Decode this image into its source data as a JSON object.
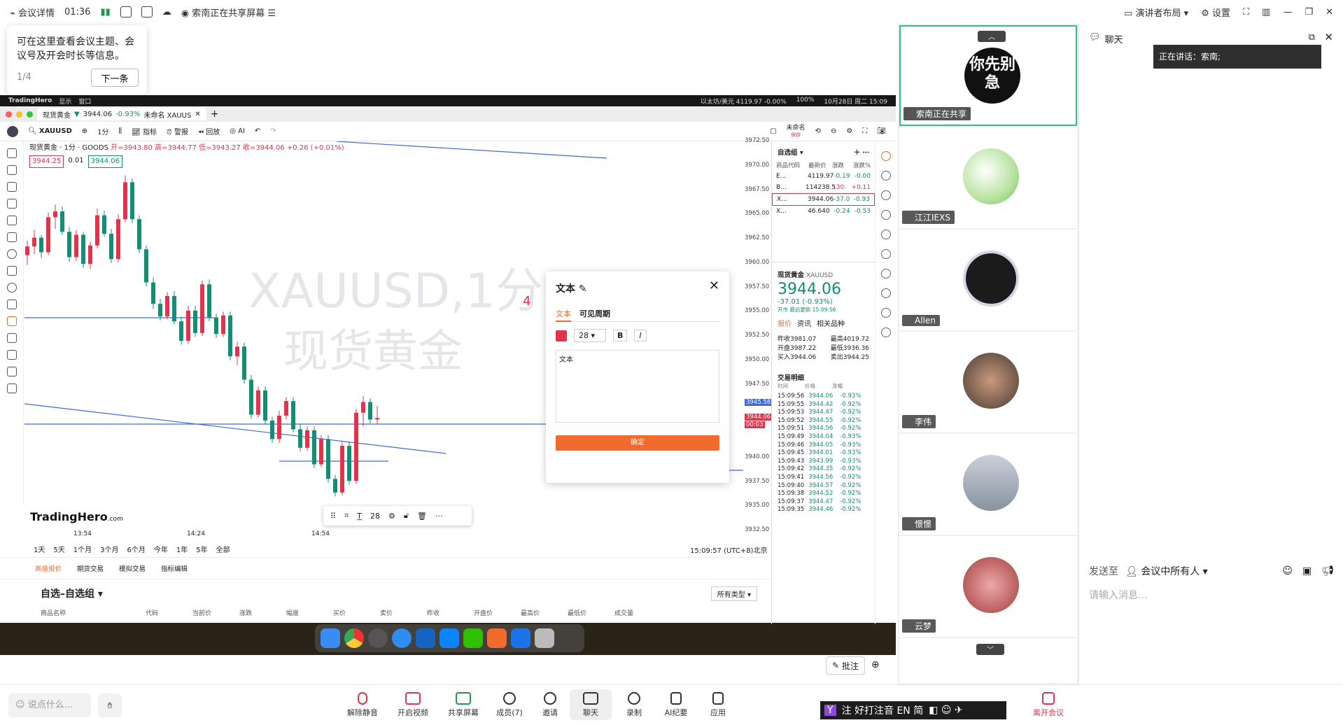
{
  "topbar": {
    "meeting_info": "会议详情",
    "time": "01:36",
    "sharing": "索南正在共享屏幕",
    "presenter_layout": "演讲者布局",
    "settings": "设置"
  },
  "tooltip": {
    "text": "可在这里查看会议主题、会议号及开会时长等信息。",
    "page": "1/4",
    "next": "下一条"
  },
  "mac_menubar": {
    "app": "TradingHero",
    "menu1": "显示",
    "menu2": "窗口",
    "ticker": "以太坊/美元 4119.97 -0.00%",
    "battery": "100%",
    "datetime": "10月28日 周二 15:09"
  },
  "tv_tab": {
    "label": "现货黄金",
    "price": "3944.06",
    "change": "-0.93%",
    "name": "未命名 XAUUS"
  },
  "tv_toolbar": {
    "symbol": "XAUUSD",
    "interval": "1分",
    "indicators": "指标",
    "alerts": "警报",
    "replay": "回放",
    "ai": "AI",
    "unnamed": "未命名",
    "save": "保存"
  },
  "legend": {
    "title": "现货黄金 · 1分 · GOODS",
    "open": "开=3943.80",
    "high": "高=3944.77",
    "low": "低=3943.27",
    "close": "收=3944.06",
    "chg": "+0.26 (+0.01%)",
    "bid": "3944.25",
    "spread": "0.01",
    "ask": "3944.06"
  },
  "watermark": {
    "line1": "XAUUSD,1分",
    "line2": "现货黄金",
    "marker": "4"
  },
  "brand": {
    "name": "TradingHero",
    "suffix": ".com"
  },
  "price_axis": [
    "3972.50",
    "3970.00",
    "3967.50",
    "3965.00",
    "3962.50",
    "3960.00",
    "3957.50",
    "3955.00",
    "3952.50",
    "3950.00",
    "3947.50",
    "3945.58",
    "3944.06",
    "00:03",
    "3940.00",
    "3937.50",
    "3935.00",
    "3932.50"
  ],
  "time_axis": [
    "13:54",
    "14:24",
    "14:54"
  ],
  "colors": {
    "up": "#e0344b",
    "down": "#138d73",
    "line": "#3d6ad6",
    "accent": "#f26a2e"
  },
  "chart_data": {
    "type": "candlestick",
    "symbol": "XAUUSD",
    "interval": "1分",
    "ylim": [
      3932.5,
      3972.5
    ],
    "candles": [
      [
        3960.8,
        3962.3,
        3959.8,
        3961.7
      ],
      [
        3961.7,
        3963.4,
        3960.9,
        3962.6
      ],
      [
        3962.6,
        3962.9,
        3960.5,
        3961.1
      ],
      [
        3961.1,
        3965.2,
        3960.8,
        3964.7
      ],
      [
        3964.7,
        3966.0,
        3963.5,
        3965.3
      ],
      [
        3965.3,
        3965.8,
        3962.9,
        3963.2
      ],
      [
        3963.2,
        3963.7,
        3960.1,
        3960.6
      ],
      [
        3960.6,
        3963.4,
        3960.2,
        3962.9
      ],
      [
        3962.9,
        3963.2,
        3959.5,
        3959.9
      ],
      [
        3959.9,
        3962.2,
        3959.4,
        3961.8
      ],
      [
        3961.8,
        3965.6,
        3961.5,
        3964.9
      ],
      [
        3964.9,
        3965.4,
        3962.7,
        3963.0
      ],
      [
        3963.0,
        3963.5,
        3960.0,
        3960.4
      ],
      [
        3960.4,
        3965.0,
        3960.1,
        3964.5
      ],
      [
        3964.5,
        3969.0,
        3964.2,
        3968.3
      ],
      [
        3968.3,
        3968.7,
        3964.1,
        3964.5
      ],
      [
        3964.5,
        3964.9,
        3961.0,
        3961.4
      ],
      [
        3961.4,
        3961.8,
        3957.6,
        3958.0
      ],
      [
        3958.0,
        3958.5,
        3955.3,
        3955.8
      ],
      [
        3955.8,
        3956.3,
        3954.1,
        3954.5
      ],
      [
        3954.5,
        3957.0,
        3954.2,
        3956.6
      ],
      [
        3956.6,
        3957.1,
        3953.7,
        3954.0
      ],
      [
        3954.0,
        3954.5,
        3951.6,
        3952.0
      ],
      [
        3952.0,
        3955.6,
        3951.7,
        3955.1
      ],
      [
        3955.1,
        3955.6,
        3952.4,
        3952.8
      ],
      [
        3952.8,
        3958.2,
        3952.5,
        3957.8
      ],
      [
        3957.8,
        3958.3,
        3954.0,
        3954.4
      ],
      [
        3954.4,
        3954.8,
        3952.3,
        3952.7
      ],
      [
        3952.7,
        3955.0,
        3952.4,
        3954.6
      ],
      [
        3954.6,
        3955.0,
        3950.0,
        3950.4
      ],
      [
        3950.4,
        3951.9,
        3949.5,
        3951.4
      ],
      [
        3951.4,
        3951.8,
        3947.6,
        3948.0
      ],
      [
        3948.0,
        3948.5,
        3944.0,
        3944.4
      ],
      [
        3944.4,
        3947.3,
        3944.1,
        3946.9
      ],
      [
        3946.9,
        3947.3,
        3943.4,
        3943.8
      ],
      [
        3943.8,
        3944.2,
        3941.5,
        3941.9
      ],
      [
        3941.9,
        3944.8,
        3941.5,
        3944.3
      ],
      [
        3944.3,
        3946.2,
        3943.9,
        3945.8
      ],
      [
        3945.8,
        3946.2,
        3942.6,
        3942.9
      ],
      [
        3942.9,
        3943.4,
        3940.6,
        3941.0
      ],
      [
        3941.0,
        3943.2,
        3940.7,
        3942.8
      ],
      [
        3942.8,
        3943.2,
        3938.9,
        3939.3
      ],
      [
        3939.3,
        3942.3,
        3939.0,
        3941.9
      ],
      [
        3941.9,
        3942.3,
        3937.4,
        3937.8
      ],
      [
        3937.8,
        3938.2,
        3936.0,
        3936.4
      ],
      [
        3936.4,
        3941.6,
        3936.1,
        3941.2
      ],
      [
        3941.2,
        3941.6,
        3937.2,
        3937.6
      ],
      [
        3937.6,
        3945.0,
        3937.3,
        3944.6
      ],
      [
        3944.6,
        3946.3,
        3943.2,
        3945.7
      ],
      [
        3945.7,
        3946.1,
        3943.5,
        3943.9
      ],
      [
        3943.9,
        3945.3,
        3943.4,
        3944.06
      ]
    ]
  },
  "periods": [
    "1天",
    "5天",
    "1个月",
    "3个月",
    "6个月",
    "今年",
    "1年",
    "5年",
    "全部"
  ],
  "timestamp": "15:09:57 (UTC+8)北京",
  "lower": {
    "tabs": [
      "高级报价",
      "期货交易",
      "模拟交易",
      "指标编辑"
    ],
    "title": "自选–自选组",
    "filter": "所有类型",
    "cols": [
      "商品名称",
      "代码",
      "当前价",
      "涨跌",
      "幅度",
      "买价",
      "卖价",
      "昨收",
      "开盘价",
      "最高价",
      "最低价",
      "成交量"
    ]
  },
  "watchlist": {
    "title": "自选组",
    "head": [
      "商品代码",
      "最新价",
      "涨跌",
      "涨跌%"
    ],
    "rows": [
      {
        "sym": "E...",
        "price": "4119.97",
        "chg": "-0.19",
        "pct": "-0.00"
      },
      {
        "sym": "B...",
        "price": "114238.5",
        "chg": "130.",
        "pct": "+0.11"
      },
      {
        "sym": "X...",
        "price": "3944.06",
        "chg": "-37.0",
        "pct": "-0.93"
      },
      {
        "sym": "X...",
        "price": "46.640",
        "chg": "-0.24",
        "pct": "-0.53"
      }
    ]
  },
  "quote": {
    "name": "现货黄金",
    "symbol": "XAUUSD",
    "price_main": "3944.",
    "price_dec": "06",
    "change": "-37.01 (-0.93%)",
    "status": "开市 最后更新 15:09:56",
    "tabs": [
      "报价",
      "资讯",
      "相关品种"
    ],
    "stats": [
      [
        "昨收",
        "3981.07",
        "最高",
        "4019.72"
      ],
      [
        "开盘",
        "3987.22",
        "最低",
        "3936.36"
      ],
      [
        "买入",
        "3944.06",
        "卖出",
        "3944.25"
      ]
    ]
  },
  "trades": {
    "title": "交易明细",
    "head": [
      "时间",
      "价格",
      "涨幅"
    ],
    "rows": [
      [
        "15:09:56",
        "3944.06",
        "-0.93%"
      ],
      [
        "15:09:55",
        "3944.42",
        "-0.92%"
      ],
      [
        "15:09:53",
        "3944.47",
        "-0.92%"
      ],
      [
        "15:09:52",
        "3944.55",
        "-0.92%"
      ],
      [
        "15:09:51",
        "3944.56",
        "-0.92%"
      ],
      [
        "15:09:49",
        "3944.04",
        "-0.93%"
      ],
      [
        "15:09:46",
        "3944.05",
        "-0.93%"
      ],
      [
        "15:09:45",
        "3944.01",
        "-0.93%"
      ],
      [
        "15:09:43",
        "3943.99",
        "-0.93%"
      ],
      [
        "15:09:42",
        "3944.35",
        "-0.92%"
      ],
      [
        "15:09:41",
        "3944.56",
        "-0.92%"
      ],
      [
        "15:09:40",
        "3944.57",
        "-0.92%"
      ],
      [
        "15:09:38",
        "3944.52",
        "-0.92%"
      ],
      [
        "15:09:37",
        "3944.47",
        "-0.92%"
      ],
      [
        "15:09:35",
        "3944.46",
        "-0.92%"
      ]
    ]
  },
  "dialog": {
    "title": "文本",
    "tab_text": "文本",
    "tab_visible": "可见周期",
    "font_size": "28",
    "bold": "B",
    "italic": "I",
    "content": "文本",
    "confirm": "确定"
  },
  "drawbar": {
    "size": "28"
  },
  "gallery": [
    {
      "name": "索南正在共享",
      "avatar_text": "你先别急"
    },
    {
      "name": "江江IEXS"
    },
    {
      "name": "Allen"
    },
    {
      "name": "李伟"
    },
    {
      "name": "憬憬"
    },
    {
      "name": "云梦"
    }
  ],
  "chat": {
    "title": "聊天",
    "speaking": "正在讲话：索南;",
    "send_to": "发送至",
    "audience": "会议中所有人",
    "placeholder": "请输入消息...",
    "send": "发送"
  },
  "bottom": {
    "say": "说点什么...",
    "buttons": [
      "解除静音",
      "开启视频",
      "共享屏幕",
      "成员(7)",
      "邀请",
      "聊天",
      "录制",
      "AI纪要",
      "应用"
    ],
    "leave": "离开会议",
    "annotate": "批注"
  },
  "ime": {
    "text": "注 好打注音 EN 简"
  }
}
